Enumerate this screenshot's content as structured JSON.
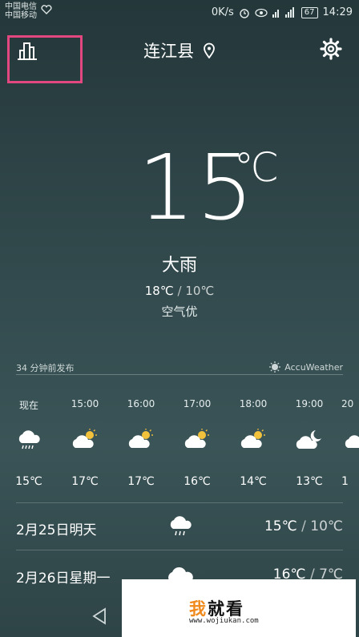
{
  "status_bar": {
    "carrier1": "中国电信",
    "carrier2": "中国移动",
    "speed": "0K/s",
    "battery": "67",
    "time": "14:29"
  },
  "header": {
    "city": "连江县",
    "icons": [
      "city-list-icon",
      "location-pin-icon",
      "gear-icon"
    ]
  },
  "current": {
    "temp": "15",
    "unit": "℃",
    "condition": "大雨",
    "high": "18℃",
    "sep": "/",
    "low": "10℃",
    "air": "空气优"
  },
  "publish": {
    "time_text": "34 分钟前发布",
    "source": "AccuWeather"
  },
  "hourly": [
    {
      "time": "现在",
      "icon": "heavy-rain-icon",
      "temp": "15℃"
    },
    {
      "time": "15:00",
      "icon": "partly-cloudy-icon",
      "temp": "17℃"
    },
    {
      "time": "16:00",
      "icon": "partly-cloudy-icon",
      "temp": "17℃"
    },
    {
      "time": "17:00",
      "icon": "partly-cloudy-icon",
      "temp": "16℃"
    },
    {
      "time": "18:00",
      "icon": "partly-cloudy-icon",
      "temp": "14℃"
    },
    {
      "time": "19:00",
      "icon": "cloudy-night-icon",
      "temp": "13℃"
    },
    {
      "time": "20",
      "icon": "cloudy-icon",
      "temp": "1"
    }
  ],
  "daily": [
    {
      "date": "2月25日明天",
      "icon": "rain-icon",
      "high": "15℃",
      "sep": "/",
      "low": "10℃"
    },
    {
      "date": "2月26日星期一",
      "icon": "cloudy-icon",
      "high": "16℃",
      "sep": "/",
      "low": "7℃"
    }
  ],
  "watermark": {
    "title_a": "我",
    "title_b": "就看",
    "url": "www.wojiukan.com"
  },
  "colors": {
    "highlight": "#e2477f",
    "sun": "#f2c23c",
    "watermark_accent": "#f08a1c"
  }
}
